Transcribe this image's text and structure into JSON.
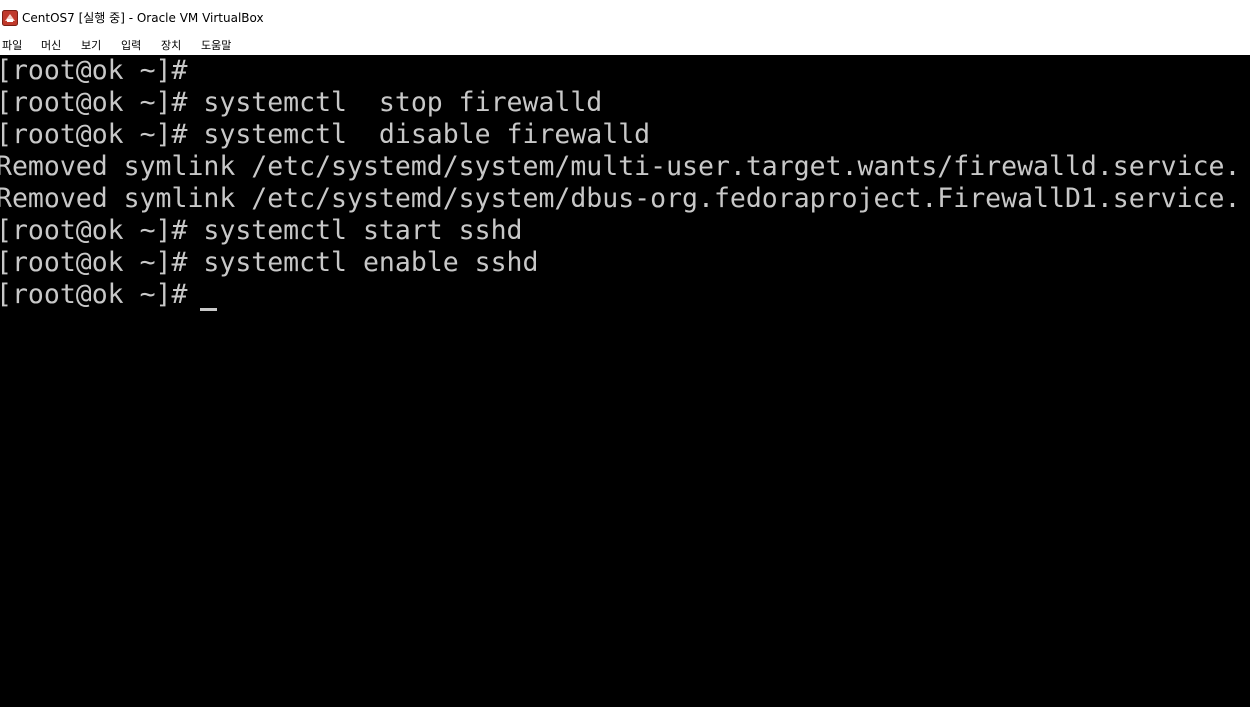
{
  "window": {
    "title": "CentOS7 [실행 중] - Oracle VM VirtualBox",
    "icon": "virtualbox-icon"
  },
  "menu": {
    "items": [
      {
        "label": "파일"
      },
      {
        "label": "머신"
      },
      {
        "label": "보기"
      },
      {
        "label": "입력"
      },
      {
        "label": "장치"
      },
      {
        "label": "도움말"
      }
    ]
  },
  "console": {
    "lines": [
      "[root@ok ~]#",
      "[root@ok ~]# systemctl  stop firewalld",
      "[root@ok ~]# systemctl  disable firewalld",
      "Removed symlink /etc/systemd/system/multi-user.target.wants/firewalld.service.",
      "Removed symlink /etc/systemd/system/dbus-org.fedoraproject.FirewallD1.service.",
      "[root@ok ~]# systemctl start sshd",
      "[root@ok ~]# systemctl enable sshd",
      "[root@ok ~]#"
    ],
    "colors": {
      "background": "#000000",
      "text": "#c8c8c8"
    }
  }
}
